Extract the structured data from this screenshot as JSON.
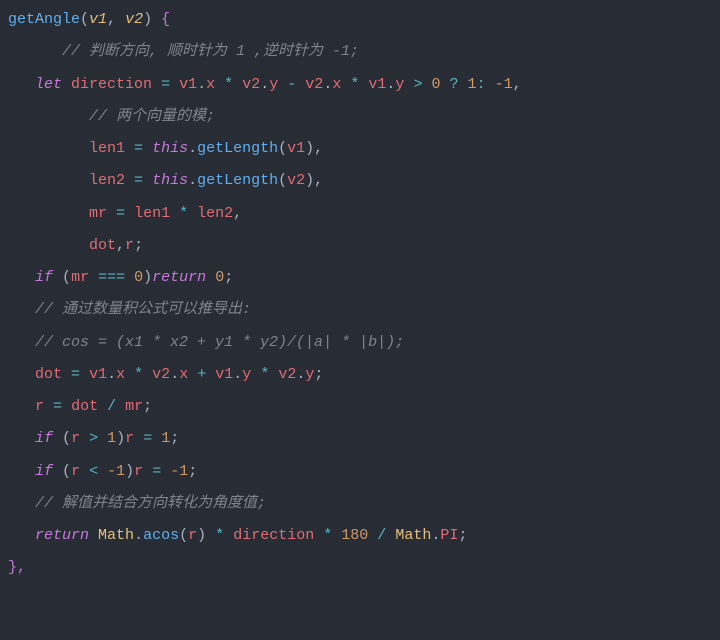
{
  "tokens": {
    "fnName": "getAngle",
    "p1": "v1",
    "p2": "v2",
    "open": " {",
    "c1": "// 判断方向, 顺时针为 1 ,逆时针为 -1;",
    "c2": "// 两个向量的模;",
    "c3": "// 通过数量积公式可以推导出:",
    "c4": "// cos = (x1 * x2 + y1 * y2)/(|a| * |b|);",
    "c5": "// 解值并结合方向转化为角度值;",
    "let": "let",
    "if": "if",
    "return": "return",
    "this": "this",
    "direction": "direction",
    "len1": "len1",
    "len2": "len2",
    "mr": "mr",
    "dot": "dot",
    "r": "r",
    "v1": "v1",
    "v2": "v2",
    "x": "x",
    "y": "y",
    "getLength": "getLength",
    "Math": "Math",
    "acos": "acos",
    "PI": "PI",
    "n0": "0",
    "n1": "1",
    "nm1": "-1",
    "n180": "180",
    "closing": "},"
  }
}
